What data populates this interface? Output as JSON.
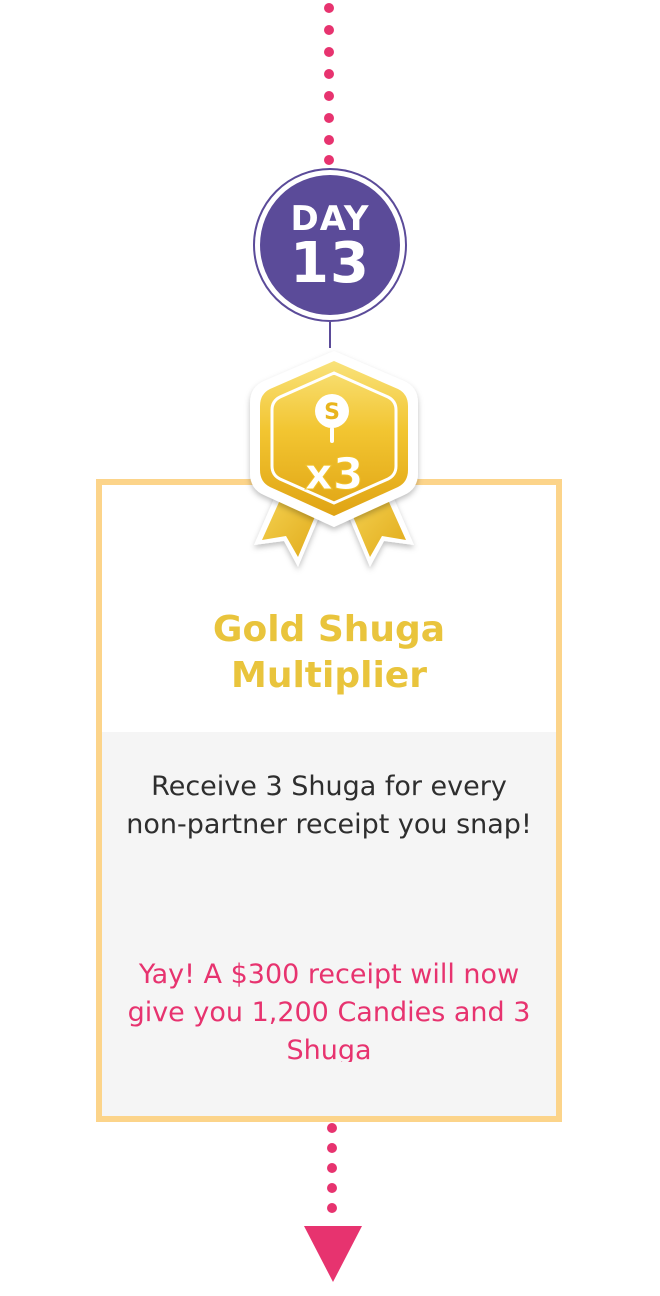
{
  "timeline": {
    "day_label": "DAY",
    "day_number": "13"
  },
  "reward": {
    "icon": "gold-ribbon-badge-icon",
    "badge_letter": "S",
    "badge_multiplier": "x3",
    "title": "Gold Shuga Multiplier",
    "description": "Receive 3 Shuga for every non-partner receipt you snap!",
    "note": "Yay! A $300 receipt will now give you 1,200 Candies and 3 Shuga"
  },
  "colors": {
    "dots": "#e7336f",
    "day_badge": "#5b4b99",
    "card_border": "#fcd48a",
    "title": "#e9c43c",
    "note": "#e7336f",
    "body_bg": "#f5f5f5"
  }
}
